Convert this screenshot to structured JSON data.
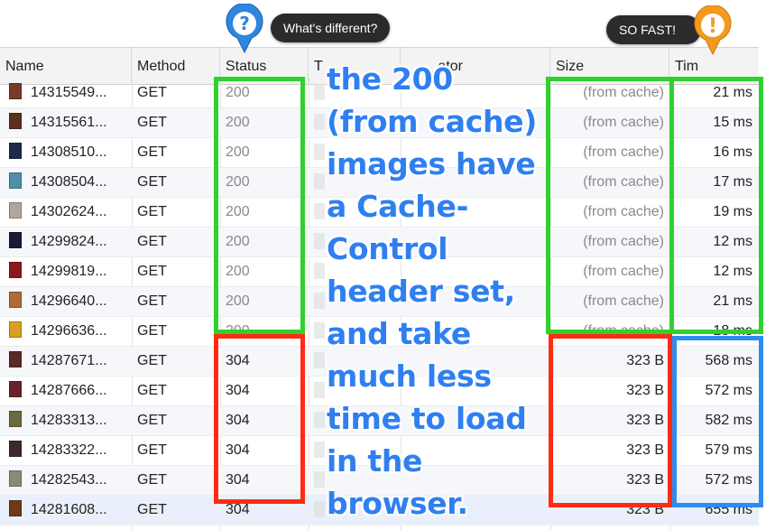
{
  "columns": {
    "name": "Name",
    "method": "Method",
    "status": "Status",
    "type": "T",
    "initiator": "ator",
    "size": "Size",
    "time": "Tim"
  },
  "rows": [
    {
      "name": "14315549...",
      "method": "GET",
      "status": "200",
      "size": "(from cache)",
      "time": "21 ms",
      "thumb": "#7a3a2a"
    },
    {
      "name": "14315561...",
      "method": "GET",
      "status": "200",
      "size": "(from cache)",
      "time": "15 ms",
      "thumb": "#5a3020"
    },
    {
      "name": "14308510...",
      "method": "GET",
      "status": "200",
      "size": "(from cache)",
      "time": "16 ms",
      "thumb": "#1e2a4a"
    },
    {
      "name": "14308504...",
      "method": "GET",
      "status": "200",
      "size": "(from cache)",
      "time": "17 ms",
      "thumb": "#4f8fa8"
    },
    {
      "name": "14302624...",
      "method": "GET",
      "status": "200",
      "size": "(from cache)",
      "time": "19 ms",
      "thumb": "#b0a69a"
    },
    {
      "name": "14299824...",
      "method": "GET",
      "status": "200",
      "size": "(from cache)",
      "time": "12 ms",
      "thumb": "#1a1a30"
    },
    {
      "name": "14299819...",
      "method": "GET",
      "status": "200",
      "size": "(from cache)",
      "time": "12 ms",
      "thumb": "#8a1a1a"
    },
    {
      "name": "14296640...",
      "method": "GET",
      "status": "200",
      "size": "(from cache)",
      "time": "21 ms",
      "thumb": "#b06a3a"
    },
    {
      "name": "14296636...",
      "method": "GET",
      "status": "200",
      "size": "(from cache)",
      "time": "18 ms",
      "thumb": "#d8a020"
    },
    {
      "name": "14287671...",
      "method": "GET",
      "status": "304",
      "size": "323 B",
      "time": "568 ms",
      "thumb": "#5a2a2a"
    },
    {
      "name": "14287666...",
      "method": "GET",
      "status": "304",
      "size": "323 B",
      "time": "572 ms",
      "thumb": "#6a2030"
    },
    {
      "name": "14283313...",
      "method": "GET",
      "status": "304",
      "size": "323 B",
      "time": "582 ms",
      "thumb": "#6a6a3a"
    },
    {
      "name": "14283322...",
      "method": "GET",
      "status": "304",
      "size": "323 B",
      "time": "579 ms",
      "thumb": "#3a2a2a"
    },
    {
      "name": "14282543...",
      "method": "GET",
      "status": "304",
      "size": "323 B",
      "time": "572 ms",
      "thumb": "#8a8a7a"
    },
    {
      "name": "14281608...",
      "method": "GET",
      "status": "304",
      "size": "323 B",
      "time": "655 ms",
      "thumb": "#6a3a1a"
    }
  ],
  "annotation": {
    "lines": [
      "the 200",
      "(from cache)",
      "images have",
      "a Cache-",
      "Control",
      "header set,",
      "and take",
      "much less",
      "time to load",
      "in the",
      "browser."
    ]
  },
  "badges": {
    "whats_different": "What's different?",
    "so_fast": "SO FAST!",
    "question_glyph": "?",
    "exclaim_glyph": "!"
  },
  "colors": {
    "green_highlight": "#2ed12e",
    "red_highlight": "#ff2b12",
    "blue_highlight": "#2d8cf0",
    "annotation_text": "#2f7ff0",
    "question_pin": "#2e86de",
    "exclaim_pin": "#f39a1e"
  }
}
